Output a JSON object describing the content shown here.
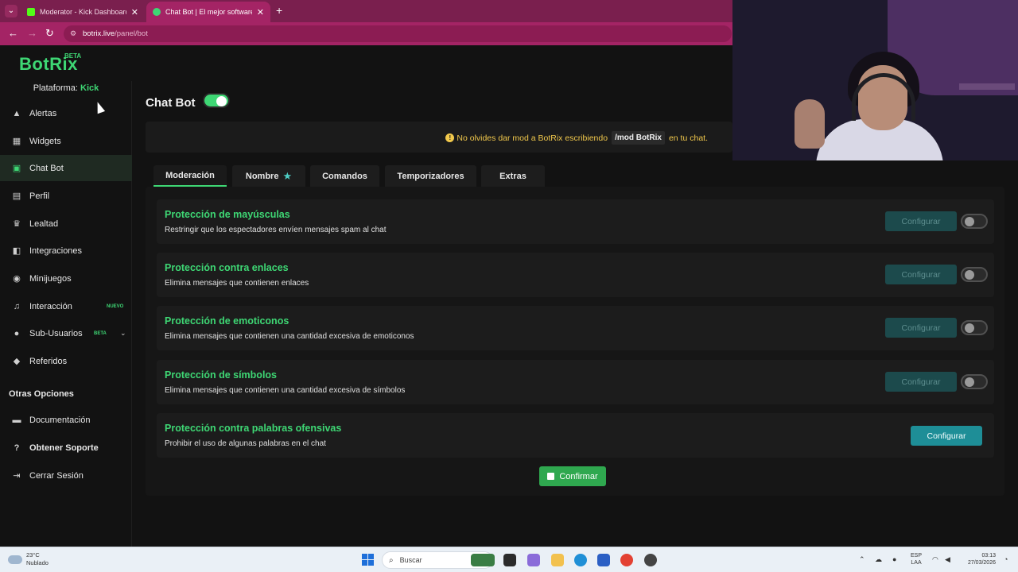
{
  "browser": {
    "tabs": [
      {
        "title": "Moderator - Kick Dashboard",
        "active": false
      },
      {
        "title": "Chat Bot | El mejor software pa",
        "active": true
      }
    ],
    "url_host": "botrix.live",
    "url_path": "/panel/bot"
  },
  "app": {
    "logo": "BotRix",
    "logo_badge": "BETA"
  },
  "sidebar": {
    "platform_label": "Plataforma:",
    "platform_value": "Kick",
    "items": [
      {
        "label": "Alertas",
        "icon": "warning-icon"
      },
      {
        "label": "Widgets",
        "icon": "widgets-icon"
      },
      {
        "label": "Chat Bot",
        "icon": "robot-icon",
        "active": true
      },
      {
        "label": "Perfil",
        "icon": "id-card-icon"
      },
      {
        "label": "Lealtad",
        "icon": "trophy-icon"
      },
      {
        "label": "Integraciones",
        "icon": "integrations-icon"
      },
      {
        "label": "Minijuegos",
        "icon": "gamepad-icon"
      },
      {
        "label": "Interacción",
        "icon": "music-icon",
        "badge": "NUEVO"
      },
      {
        "label": "Sub-Usuarios",
        "icon": "users-icon",
        "badge": "BETA"
      },
      {
        "label": "Referidos",
        "icon": "referrals-icon"
      }
    ],
    "other_title": "Otras Opciones",
    "other_items": [
      {
        "label": "Documentación",
        "icon": "document-icon"
      },
      {
        "label": "Obtener Soporte",
        "icon": "help-icon"
      },
      {
        "label": "Cerrar Sesión",
        "icon": "logout-icon"
      }
    ]
  },
  "main": {
    "title": "Chat Bot",
    "toggle_on": true,
    "notice": {
      "text_before": "No olvides dar mod a BotRix escribiendo",
      "command": "/mod BotRix",
      "text_after": "en tu chat."
    },
    "tabs": [
      {
        "label": "Moderación",
        "active": true
      },
      {
        "label": "Nombre",
        "star": true
      },
      {
        "label": "Comandos"
      },
      {
        "label": "Temporizadores"
      },
      {
        "label": "Extras"
      }
    ],
    "protections": [
      {
        "title": "Protección de mayúsculas",
        "desc": "Restringir que los espectadores envíen mensajes spam al chat",
        "button": "Configurar",
        "enabled": false
      },
      {
        "title": "Protección contra enlaces",
        "desc": "Elimina mensajes que contienen enlaces",
        "button": "Configurar",
        "enabled": false
      },
      {
        "title": "Protección de emoticonos",
        "desc": "Elimina mensajes que contienen una cantidad excesiva de emoticonos",
        "button": "Configurar",
        "enabled": false
      },
      {
        "title": "Protección de símbolos",
        "desc": "Elimina mensajes que contienen una cantidad excesiva de símbolos",
        "button": "Configurar",
        "enabled": false
      },
      {
        "title": "Protección contra palabras ofensivas",
        "desc": "Prohibir el uso de algunas palabras en el chat",
        "button": "Configurar",
        "enabled": true
      }
    ],
    "confirm_label": "Confirmar"
  },
  "taskbar": {
    "weather_temp": "23°C",
    "weather_desc": "Nublado",
    "search_placeholder": "Buscar",
    "lang_top": "ESP",
    "lang_bottom": "LAA",
    "time": "03:13",
    "date": "27/03/2026"
  },
  "colors": {
    "accent_green": "#3ed774",
    "browser_magenta": "#a42465",
    "configure_teal": "#1e8e97",
    "notice_yellow": "#f2c94c"
  }
}
